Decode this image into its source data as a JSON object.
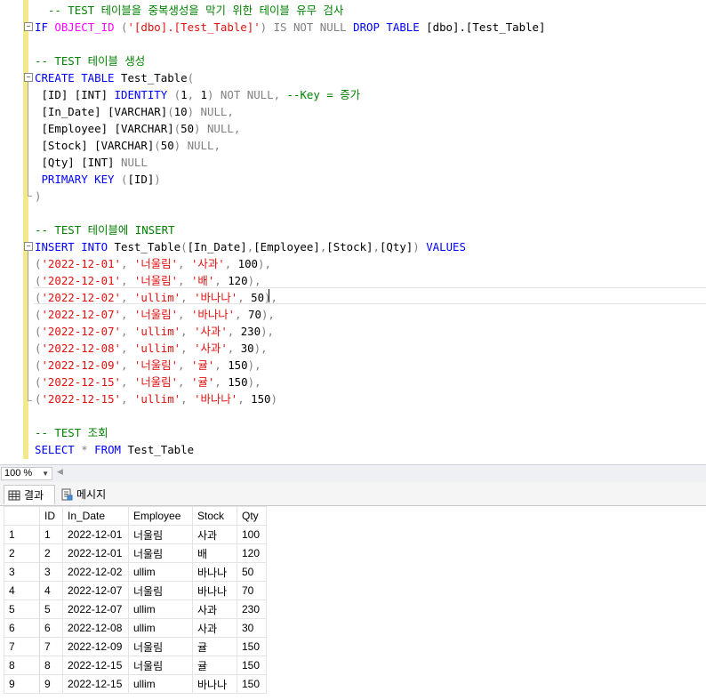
{
  "editor": {
    "lines": [
      {
        "segments": [
          {
            "t": "  -- TEST 테이블을 중복생성을 막기 위한 테이블 유무 검사",
            "c": "cm"
          }
        ]
      },
      {
        "segments": [
          {
            "t": "IF ",
            "c": "kw"
          },
          {
            "t": "OBJECT_ID",
            "c": "fn"
          },
          {
            "t": " (",
            "c": "gr"
          },
          {
            "t": "'[dbo].[Test_Table]'",
            "c": "str"
          },
          {
            "t": ")",
            "c": "gr"
          },
          {
            "t": " IS NOT NULL ",
            "c": "gr"
          },
          {
            "t": "DROP TABLE",
            "c": "kw"
          },
          {
            "t": " [dbo].[Test_Table]",
            "c": ""
          }
        ]
      },
      {
        "segments": []
      },
      {
        "segments": [
          {
            "t": "-- TEST 테이블 생성",
            "c": "cm"
          }
        ]
      },
      {
        "segments": [
          {
            "t": "CREATE TABLE",
            "c": "kw"
          },
          {
            "t": " Test_Table",
            "c": ""
          },
          {
            "t": "(",
            "c": "gr"
          }
        ]
      },
      {
        "segments": [
          {
            "t": " [ID] [INT] ",
            "c": ""
          },
          {
            "t": "IDENTITY",
            "c": "kw"
          },
          {
            "t": " (",
            "c": "gr"
          },
          {
            "t": "1",
            "c": ""
          },
          {
            "t": ", ",
            "c": "gr"
          },
          {
            "t": "1",
            "c": ""
          },
          {
            "t": ")",
            "c": "gr"
          },
          {
            "t": " NOT NULL, ",
            "c": "gr"
          },
          {
            "t": "--Key = 증가",
            "c": "cm"
          }
        ]
      },
      {
        "segments": [
          {
            "t": " [In_Date] [VARCHAR]",
            "c": ""
          },
          {
            "t": "(",
            "c": "gr"
          },
          {
            "t": "10",
            "c": ""
          },
          {
            "t": ")",
            "c": "gr"
          },
          {
            "t": " NULL,",
            "c": "gr"
          }
        ]
      },
      {
        "segments": [
          {
            "t": " [Employee] [VARCHAR]",
            "c": ""
          },
          {
            "t": "(",
            "c": "gr"
          },
          {
            "t": "50",
            "c": ""
          },
          {
            "t": ")",
            "c": "gr"
          },
          {
            "t": " NULL,",
            "c": "gr"
          }
        ]
      },
      {
        "segments": [
          {
            "t": " [Stock] [VARCHAR]",
            "c": ""
          },
          {
            "t": "(",
            "c": "gr"
          },
          {
            "t": "50",
            "c": ""
          },
          {
            "t": ")",
            "c": "gr"
          },
          {
            "t": " NULL,",
            "c": "gr"
          }
        ]
      },
      {
        "segments": [
          {
            "t": " [Qty] [INT] ",
            "c": ""
          },
          {
            "t": "NULL",
            "c": "gr"
          }
        ]
      },
      {
        "segments": [
          {
            "t": " PRIMARY KEY",
            "c": "kw"
          },
          {
            "t": " (",
            "c": "gr"
          },
          {
            "t": "[ID]",
            "c": ""
          },
          {
            "t": ")",
            "c": "gr"
          }
        ]
      },
      {
        "segments": [
          {
            "t": ")",
            "c": "gr"
          }
        ]
      },
      {
        "segments": []
      },
      {
        "segments": [
          {
            "t": "-- TEST 테이블에 INSERT",
            "c": "cm"
          }
        ]
      },
      {
        "segments": [
          {
            "t": "INSERT INTO",
            "c": "kw"
          },
          {
            "t": " Test_Table",
            "c": ""
          },
          {
            "t": "(",
            "c": "gr"
          },
          {
            "t": "[In_Date]",
            "c": ""
          },
          {
            "t": ",",
            "c": "gr"
          },
          {
            "t": "[Employee]",
            "c": ""
          },
          {
            "t": ",",
            "c": "gr"
          },
          {
            "t": "[Stock]",
            "c": ""
          },
          {
            "t": ",",
            "c": "gr"
          },
          {
            "t": "[Qty]",
            "c": ""
          },
          {
            "t": ") ",
            "c": "gr"
          },
          {
            "t": "VALUES",
            "c": "kw"
          }
        ]
      },
      {
        "segments": [
          {
            "t": "(",
            "c": "gr"
          },
          {
            "t": "'2022-12-01'",
            "c": "str"
          },
          {
            "t": ", ",
            "c": "gr"
          },
          {
            "t": "'너울림'",
            "c": "str"
          },
          {
            "t": ", ",
            "c": "gr"
          },
          {
            "t": "'사과'",
            "c": "str"
          },
          {
            "t": ", ",
            "c": "gr"
          },
          {
            "t": "100",
            "c": ""
          },
          {
            "t": "),",
            "c": "gr"
          }
        ]
      },
      {
        "segments": [
          {
            "t": "(",
            "c": "gr"
          },
          {
            "t": "'2022-12-01'",
            "c": "str"
          },
          {
            "t": ", ",
            "c": "gr"
          },
          {
            "t": "'너울림'",
            "c": "str"
          },
          {
            "t": ", ",
            "c": "gr"
          },
          {
            "t": "'배'",
            "c": "str"
          },
          {
            "t": ", ",
            "c": "gr"
          },
          {
            "t": "120",
            "c": ""
          },
          {
            "t": "),",
            "c": "gr"
          }
        ]
      },
      {
        "segments": [
          {
            "t": "(",
            "c": "gr"
          },
          {
            "t": "'2022-12-02'",
            "c": "str"
          },
          {
            "t": ", ",
            "c": "gr"
          },
          {
            "t": "'ullim'",
            "c": "str"
          },
          {
            "t": ", ",
            "c": "gr"
          },
          {
            "t": "'바나나'",
            "c": "str"
          },
          {
            "t": ", ",
            "c": "gr"
          },
          {
            "t": "50",
            "c": ""
          },
          {
            "t": "),",
            "c": "gr"
          }
        ]
      },
      {
        "segments": [
          {
            "t": "(",
            "c": "gr"
          },
          {
            "t": "'2022-12-07'",
            "c": "str"
          },
          {
            "t": ", ",
            "c": "gr"
          },
          {
            "t": "'너울림'",
            "c": "str"
          },
          {
            "t": ", ",
            "c": "gr"
          },
          {
            "t": "'바나나'",
            "c": "str"
          },
          {
            "t": ", ",
            "c": "gr"
          },
          {
            "t": "70",
            "c": ""
          },
          {
            "t": "),",
            "c": "gr"
          }
        ]
      },
      {
        "segments": [
          {
            "t": "(",
            "c": "gr"
          },
          {
            "t": "'2022-12-07'",
            "c": "str"
          },
          {
            "t": ", ",
            "c": "gr"
          },
          {
            "t": "'ullim'",
            "c": "str"
          },
          {
            "t": ", ",
            "c": "gr"
          },
          {
            "t": "'사과'",
            "c": "str"
          },
          {
            "t": ", ",
            "c": "gr"
          },
          {
            "t": "230",
            "c": ""
          },
          {
            "t": "),",
            "c": "gr"
          }
        ]
      },
      {
        "segments": [
          {
            "t": "(",
            "c": "gr"
          },
          {
            "t": "'2022-12-08'",
            "c": "str"
          },
          {
            "t": ", ",
            "c": "gr"
          },
          {
            "t": "'ullim'",
            "c": "str"
          },
          {
            "t": ", ",
            "c": "gr"
          },
          {
            "t": "'사과'",
            "c": "str"
          },
          {
            "t": ", ",
            "c": "gr"
          },
          {
            "t": "30",
            "c": ""
          },
          {
            "t": "),",
            "c": "gr"
          }
        ]
      },
      {
        "segments": [
          {
            "t": "(",
            "c": "gr"
          },
          {
            "t": "'2022-12-09'",
            "c": "str"
          },
          {
            "t": ", ",
            "c": "gr"
          },
          {
            "t": "'너울림'",
            "c": "str"
          },
          {
            "t": ", ",
            "c": "gr"
          },
          {
            "t": "'귤'",
            "c": "str"
          },
          {
            "t": ", ",
            "c": "gr"
          },
          {
            "t": "150",
            "c": ""
          },
          {
            "t": "),",
            "c": "gr"
          }
        ]
      },
      {
        "segments": [
          {
            "t": "(",
            "c": "gr"
          },
          {
            "t": "'2022-12-15'",
            "c": "str"
          },
          {
            "t": ", ",
            "c": "gr"
          },
          {
            "t": "'너울림'",
            "c": "str"
          },
          {
            "t": ", ",
            "c": "gr"
          },
          {
            "t": "'귤'",
            "c": "str"
          },
          {
            "t": ", ",
            "c": "gr"
          },
          {
            "t": "150",
            "c": ""
          },
          {
            "t": "),",
            "c": "gr"
          }
        ]
      },
      {
        "segments": [
          {
            "t": "(",
            "c": "gr"
          },
          {
            "t": "'2022-12-15'",
            "c": "str"
          },
          {
            "t": ", ",
            "c": "gr"
          },
          {
            "t": "'ullim'",
            "c": "str"
          },
          {
            "t": ", ",
            "c": "gr"
          },
          {
            "t": "'바나나'",
            "c": "str"
          },
          {
            "t": ", ",
            "c": "gr"
          },
          {
            "t": "150",
            "c": ""
          },
          {
            "t": ")",
            "c": "gr"
          }
        ]
      },
      {
        "segments": []
      },
      {
        "segments": [
          {
            "t": "-- TEST 조회",
            "c": "cm"
          }
        ]
      },
      {
        "segments": [
          {
            "t": "SELECT",
            "c": "kw"
          },
          {
            "t": " * ",
            "c": "gr"
          },
          {
            "t": "FROM",
            "c": "kw"
          },
          {
            "t": " Test_Table",
            "c": ""
          }
        ]
      }
    ]
  },
  "zoom": {
    "value": "100 %"
  },
  "tabs": [
    {
      "label": "결과",
      "icon": "grid-icon",
      "active": true
    },
    {
      "label": "메시지",
      "icon": "message-icon",
      "active": false
    }
  ],
  "grid": {
    "columns": [
      "ID",
      "In_Date",
      "Employee",
      "Stock",
      "Qty"
    ],
    "rows": [
      [
        "1",
        "1",
        "2022-12-01",
        "너울림",
        "사과",
        "100"
      ],
      [
        "2",
        "2",
        "2022-12-01",
        "너울림",
        "배",
        "120"
      ],
      [
        "3",
        "3",
        "2022-12-02",
        "ullim",
        "바나나",
        "50"
      ],
      [
        "4",
        "4",
        "2022-12-07",
        "너울림",
        "바나나",
        "70"
      ],
      [
        "5",
        "5",
        "2022-12-07",
        "ullim",
        "사과",
        "230"
      ],
      [
        "6",
        "6",
        "2022-12-08",
        "ullim",
        "사과",
        "30"
      ],
      [
        "7",
        "7",
        "2022-12-09",
        "너울림",
        "귤",
        "150"
      ],
      [
        "8",
        "8",
        "2022-12-15",
        "너울림",
        "귤",
        "150"
      ],
      [
        "9",
        "9",
        "2022-12-15",
        "ullim",
        "바나나",
        "150"
      ]
    ]
  }
}
